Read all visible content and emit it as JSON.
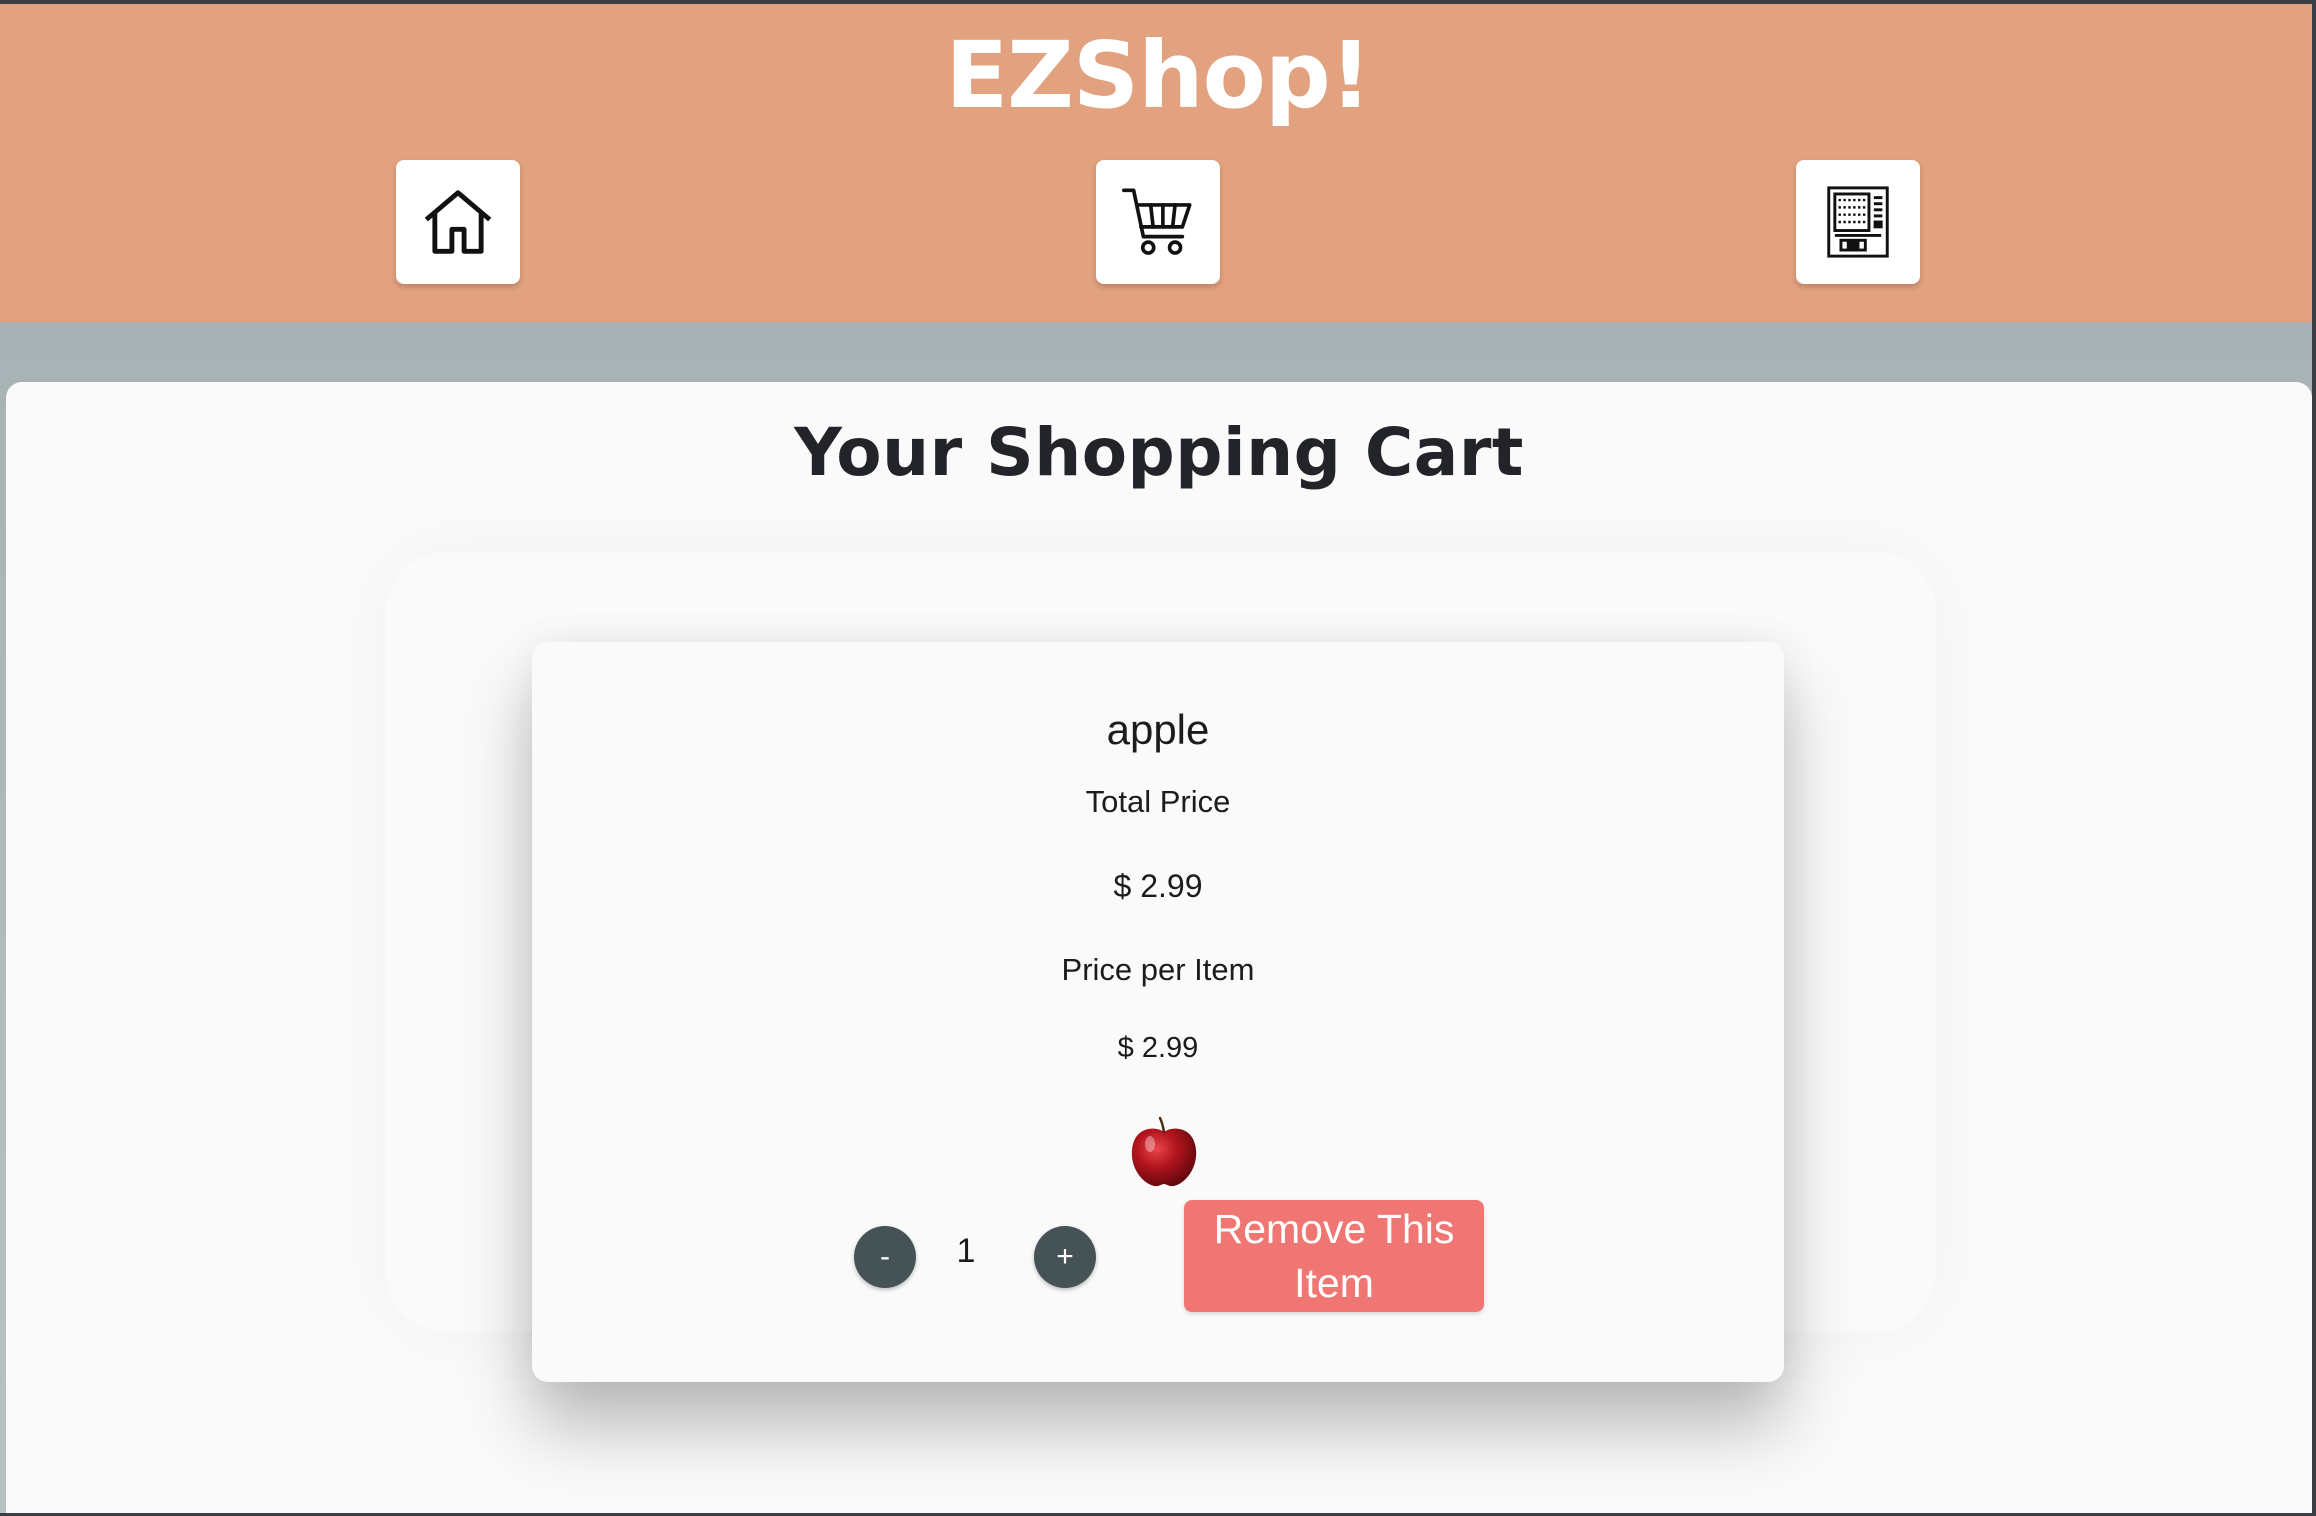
{
  "header": {
    "brand": "EZShop!",
    "nav": [
      {
        "icon": "home-icon"
      },
      {
        "icon": "cart-icon"
      },
      {
        "icon": "vending-machine-icon"
      }
    ],
    "background_color": "#e2a17f"
  },
  "main": {
    "title": "Your Shopping Cart",
    "cart_items": [
      {
        "name": "apple",
        "total_price_label": "Total Price",
        "total_price": "$ 2.99",
        "price_per_item_label": "Price per Item",
        "price_per_item": "$ 2.99",
        "image_icon": "apple-image",
        "decrease_label": "-",
        "quantity": "1",
        "increase_label": "+",
        "remove_label": "Remove This Item"
      }
    ]
  },
  "colors": {
    "accent_remove": "#ef7672",
    "qty_button": "#465356"
  }
}
